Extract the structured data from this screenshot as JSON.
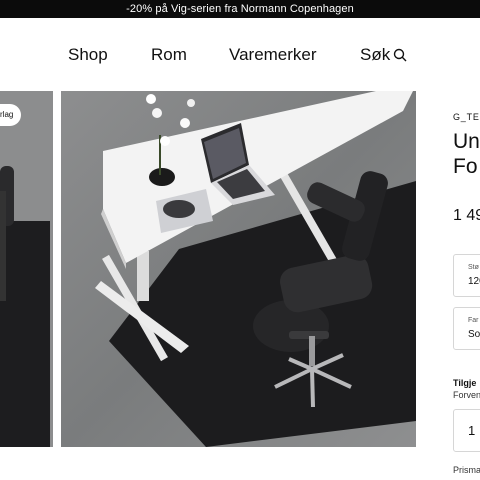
{
  "promo": {
    "text": "-20% på Vig-serien fra Normann Copenhagen"
  },
  "nav": {
    "shop": "Shop",
    "rooms": "Rom",
    "brands": "Varemerker",
    "search": "Søk"
  },
  "gallery": {
    "badge": "rlag"
  },
  "product": {
    "brand": "G_TE",
    "title_line1": "Un",
    "title_line2": "Fo",
    "price": "1 49",
    "size": {
      "label": "Stø",
      "value": "120"
    },
    "color": {
      "label": "Far",
      "value": "So"
    },
    "availability_title": "Tilgje",
    "availability_sub": "Forven",
    "quantity": "1",
    "price_match": "Prisma"
  },
  "colors": {
    "promo_bg": "#0b0b0b",
    "border": "#d6d6d6",
    "floor": "#7d7f80",
    "desk_top": "#f2f2f2",
    "mat": "#1c1c1e"
  },
  "icons": {
    "search": "search-icon"
  }
}
